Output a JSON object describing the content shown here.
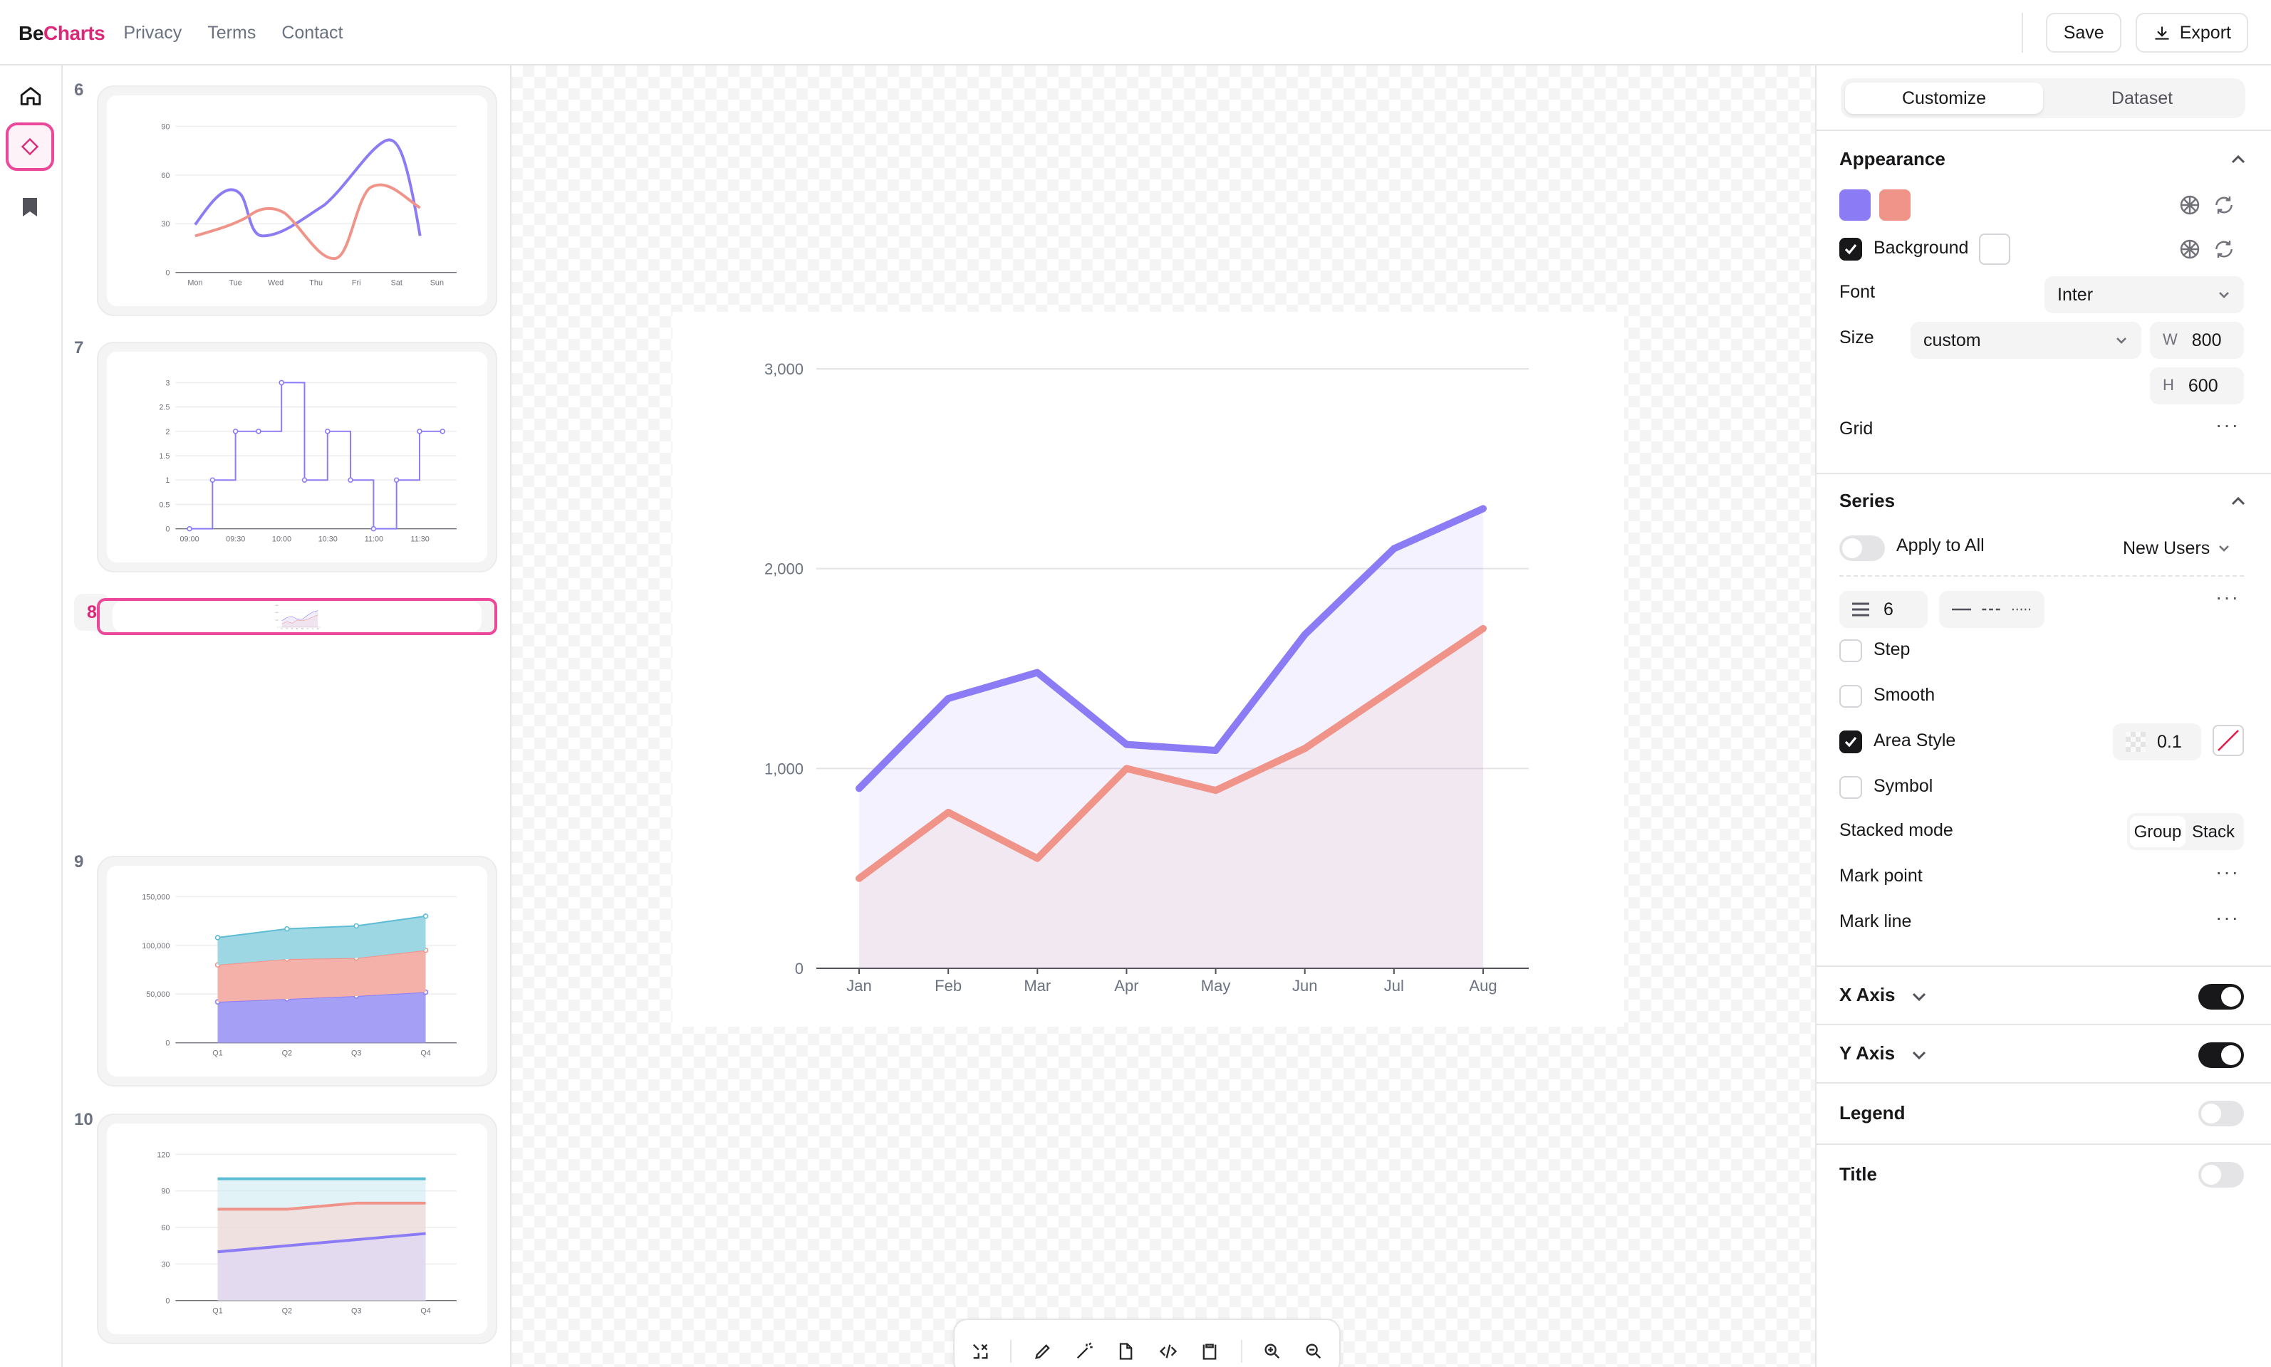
{
  "header": {
    "brand_prefix": "Be",
    "brand_suffix": "Charts",
    "nav": [
      "Privacy",
      "Terms",
      "Contact"
    ],
    "save_label": "Save",
    "export_label": "Export"
  },
  "rail": {
    "items": [
      "home-icon",
      "diamond-icon",
      "bookmark-icon"
    ],
    "active": "diamond-icon"
  },
  "thumbnails": [
    {
      "number": "6",
      "type": "smooth-line",
      "x_labels": [
        "Mon",
        "Tue",
        "Wed",
        "Thu",
        "Fri",
        "Sat",
        "Sun"
      ],
      "y_labels": [
        "0",
        "30",
        "60",
        "90"
      ]
    },
    {
      "number": "7",
      "type": "step-line",
      "x_labels": [
        "09:00",
        "09:30",
        "10:00",
        "10:30",
        "11:00",
        "11:30"
      ],
      "y_labels": [
        "0",
        "0.5",
        "1",
        "1.5",
        "2",
        "2.5",
        "3"
      ]
    },
    {
      "number": "8",
      "type": "area",
      "selected": true,
      "x_labels": [
        "Jan",
        "Feb",
        "Mar",
        "Apr",
        "May",
        "Jun",
        "Jul",
        "Aug"
      ],
      "y_labels": [
        "0",
        "1,000",
        "2,000",
        "3,000"
      ]
    },
    {
      "number": "9",
      "type": "stacked-area",
      "x_labels": [
        "Q1",
        "Q2",
        "Q3",
        "Q4"
      ],
      "y_labels": [
        "0",
        "50,000",
        "100,000",
        "150,000"
      ]
    },
    {
      "number": "10",
      "type": "area-lines",
      "x_labels": [
        "Q1",
        "Q2",
        "Q3",
        "Q4"
      ],
      "y_labels": [
        "0",
        "30",
        "60",
        "90",
        "120"
      ]
    }
  ],
  "chart_data": {
    "type": "area",
    "categories": [
      "Jan",
      "Feb",
      "Mar",
      "Apr",
      "May",
      "Jun",
      "Jul",
      "Aug"
    ],
    "series": [
      {
        "values": [
          900,
          1350,
          1480,
          1120,
          1090,
          1670,
          2100,
          2300
        ],
        "color": "#8b7cf6"
      },
      {
        "values": [
          450,
          780,
          550,
          1000,
          890,
          1100,
          1400,
          1700
        ],
        "color": "#f0948a"
      }
    ],
    "y_ticks": [
      "0",
      "1,000",
      "2,000",
      "3,000"
    ],
    "ylim": [
      0,
      3000
    ],
    "grid": true,
    "area_opacity": 0.1
  },
  "panel": {
    "tabs": [
      "Customize",
      "Dataset"
    ],
    "active_tab": "Customize",
    "appearance": {
      "title": "Appearance",
      "colors": [
        "#8b7cf6",
        "#f0948a"
      ],
      "background_label": "Background",
      "background_checked": true,
      "font_label": "Font",
      "font_value": "Inter",
      "size_label": "Size",
      "size_value": "custom",
      "width_label": "W",
      "width_value": "800",
      "height_label": "H",
      "height_value": "600",
      "grid_label": "Grid"
    },
    "series": {
      "title": "Series",
      "apply_all_label": "Apply to All",
      "apply_all_on": false,
      "series_select": "New Users",
      "line_width": "6",
      "step_label": "Step",
      "step_checked": false,
      "smooth_label": "Smooth",
      "smooth_checked": false,
      "area_label": "Area Style",
      "area_checked": true,
      "area_opacity": "0.1",
      "symbol_label": "Symbol",
      "symbol_checked": false,
      "stacked_label": "Stacked mode",
      "group_label": "Group",
      "stack_label": "Stack",
      "markpoint_label": "Mark point",
      "markline_label": "Mark line"
    },
    "x_axis": {
      "label": "X Axis",
      "on": true
    },
    "y_axis": {
      "label": "Y Axis",
      "on": true
    },
    "legend": {
      "label": "Legend",
      "on": false
    },
    "title_toggle": {
      "label": "Title",
      "on": false
    }
  },
  "toolbar": {
    "icons": [
      "shuffle-icon",
      "pencil-icon",
      "magic-wand-icon",
      "file-icon",
      "code-icon",
      "clipboard-icon",
      "zoom-in-icon",
      "zoom-out-icon"
    ]
  }
}
